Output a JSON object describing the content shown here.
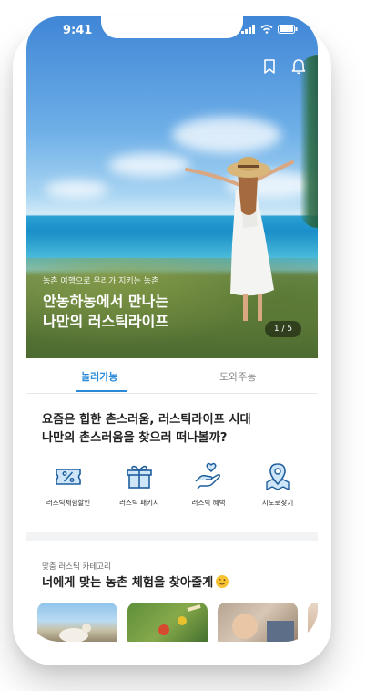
{
  "status": {
    "time": "9:41"
  },
  "hero": {
    "subtitle": "농촌 여행으로 우리가 지키는 농촌",
    "title_line1": "안농하농에서 만나는",
    "title_line2": "나만의 러스틱라이프",
    "pager": "1 / 5"
  },
  "tabs": [
    {
      "label": "놀러가농",
      "active": true
    },
    {
      "label": "도와주농",
      "active": false
    }
  ],
  "section1": {
    "title_line1": "요즘은 힙한 촌스러움, 러스틱라이프 시대",
    "title_line2": "나만의 촌스러움을 찾으러 떠나볼까?"
  },
  "categories": [
    {
      "label": "러스틱체험할인",
      "icon": "discount-ticket-icon"
    },
    {
      "label": "러스틱 패키지",
      "icon": "gift-box-icon"
    },
    {
      "label": "러스틱 혜택",
      "icon": "heart-hand-icon"
    },
    {
      "label": "지도로찾기",
      "icon": "map-pin-icon"
    }
  ],
  "section2": {
    "subtitle": "맞춤 러스틱 카테고리",
    "title": "너에게 맞는 농촌 체험을 찾아줄게"
  },
  "colors": {
    "accent": "#2b8ad8",
    "icon_fill": "#cfe6f8",
    "icon_stroke": "#1f5f9e"
  }
}
